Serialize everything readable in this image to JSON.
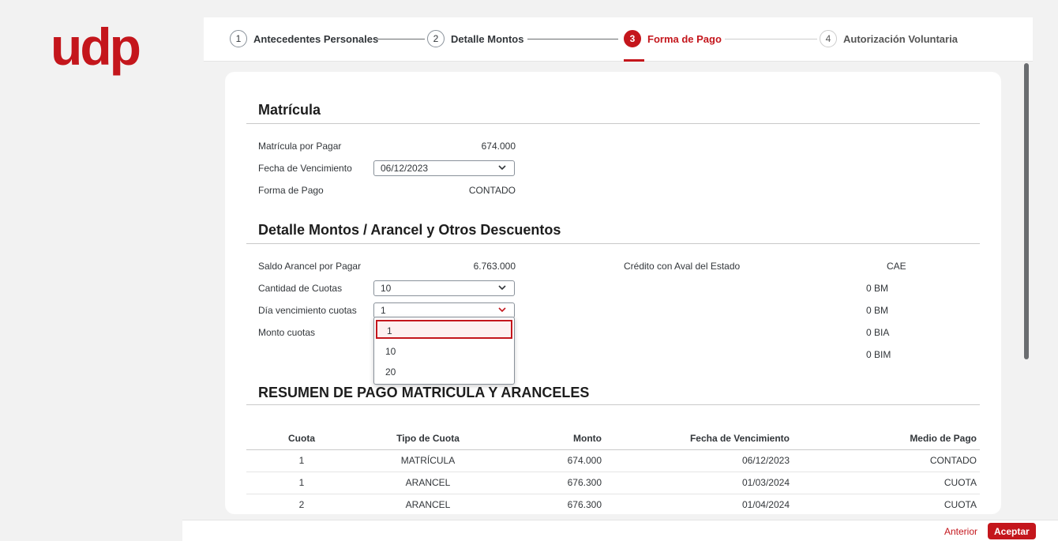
{
  "brand": {
    "logo_text": "udp",
    "accent": "#c4161c"
  },
  "steps": [
    {
      "number": "1",
      "label": "Antecedentes Personales",
      "state": "done"
    },
    {
      "number": "2",
      "label": "Detalle Montos",
      "state": "done"
    },
    {
      "number": "3",
      "label": "Forma de Pago",
      "state": "active"
    },
    {
      "number": "4",
      "label": "Autorización Voluntaria",
      "state": "pending"
    }
  ],
  "matricula": {
    "title": "Matrícula",
    "por_pagar_label": "Matrícula por Pagar",
    "por_pagar_value": "674.000",
    "vencimiento_label": "Fecha de Vencimiento",
    "vencimiento_value": "06/12/2023",
    "forma_pago_label": "Forma de Pago",
    "forma_pago_value": "CONTADO"
  },
  "detalle": {
    "title": "Detalle Montos / Arancel y Otros Descuentos",
    "saldo_label": "Saldo Arancel por Pagar",
    "saldo_value": "6.763.000",
    "cuotas_label": "Cantidad de Cuotas",
    "cuotas_value": "10",
    "dia_label": "Día vencimiento cuotas",
    "dia_value": "1",
    "monto_label": "Monto cuotas",
    "credito_label": "Crédito con Aval del Estado",
    "credito_value": "CAE",
    "becas": [
      "0 BM",
      "0 BM",
      "0 BIA",
      "0 BIM"
    ]
  },
  "dropdown": {
    "options": [
      "1",
      "10",
      "20"
    ],
    "selected": "1"
  },
  "resumen": {
    "title": "RESUMEN DE PAGO MATRICULA Y ARANCELES",
    "columns": [
      "Cuota",
      "Tipo de Cuota",
      "Monto",
      "Fecha de Vencimiento",
      "Medio de Pago"
    ],
    "rows": [
      [
        "1",
        "MATRÍCULA",
        "674.000",
        "06/12/2023",
        "CONTADO"
      ],
      [
        "1",
        "ARANCEL",
        "676.300",
        "01/03/2024",
        "CUOTA"
      ],
      [
        "2",
        "ARANCEL",
        "676.300",
        "01/04/2024",
        "CUOTA"
      ]
    ]
  },
  "footer": {
    "back_label": "Anterior",
    "accept_label": "Aceptar"
  }
}
